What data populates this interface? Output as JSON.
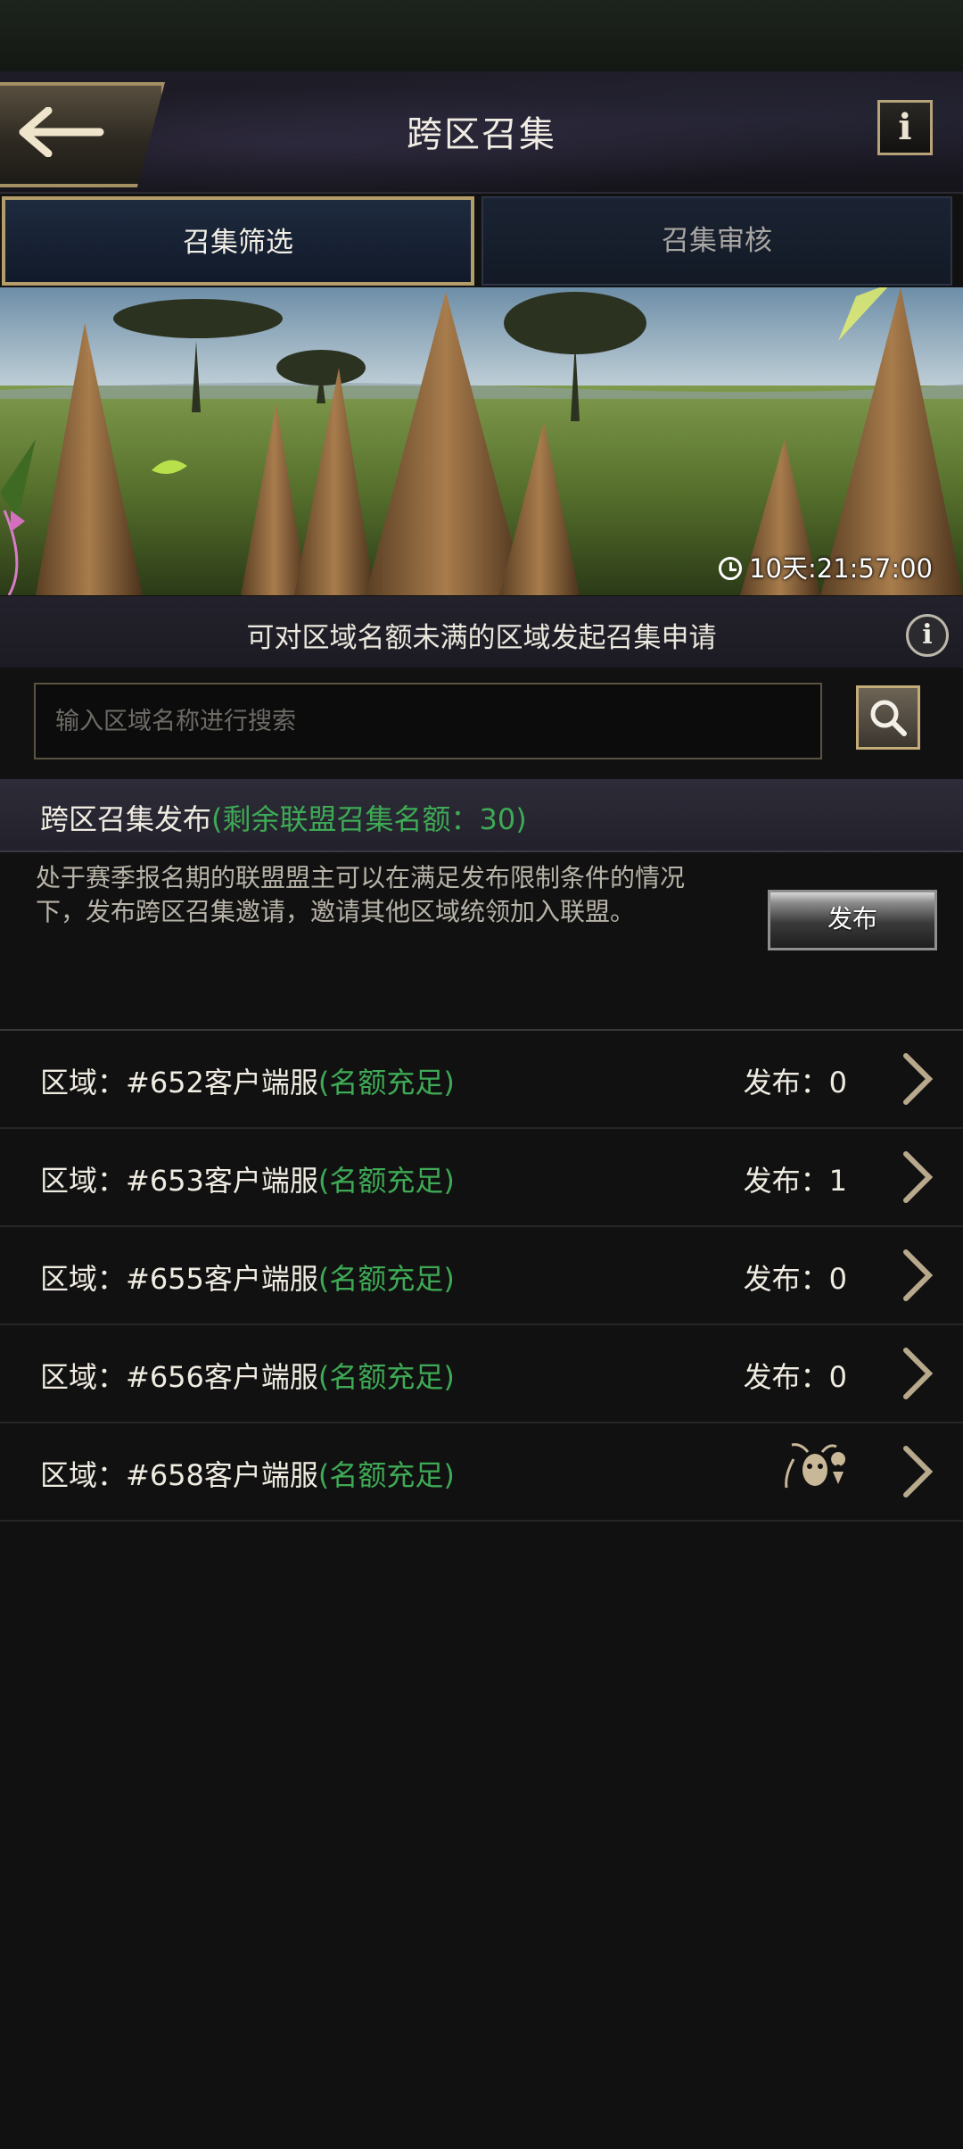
{
  "header": {
    "title": "跨区召集",
    "info_label": "i"
  },
  "tabs": [
    {
      "label": "召集筛选",
      "active": true
    },
    {
      "label": "召集审核",
      "active": false
    }
  ],
  "banner": {
    "timer": "10天:21:57:00"
  },
  "notice": {
    "text": "可对区域名额未满的区域发起召集申请",
    "info_label": "i"
  },
  "search": {
    "placeholder": "输入区域名称进行搜索",
    "value": ""
  },
  "publish_section": {
    "title": "跨区召集发布",
    "quota": "(剩余联盟召集名额：30)",
    "description": "处于赛季报名期的联盟盟主可以在满足发布限制条件的情况下，发布跨区召集邀请，邀请其他区域统领加入联盟。",
    "button_label": "发布"
  },
  "regions": [
    {
      "label": "区域：#652客户端服",
      "status": "(名额充足)",
      "count": "发布：0"
    },
    {
      "label": "区域：#653客户端服",
      "status": "(名额充足)",
      "count": "发布：1"
    },
    {
      "label": "区域：#655客户端服",
      "status": "(名额充足)",
      "count": "发布：0"
    },
    {
      "label": "区域：#656客户端服",
      "status": "(名额充足)",
      "count": "发布：0"
    },
    {
      "label": "区域：#658客户端服",
      "status": "(名额充足)",
      "count": "",
      "icon": "ant-location-icon"
    }
  ],
  "colors": {
    "accent_gold": "#b59d6a",
    "status_green": "#3eaa55",
    "background": "#111111"
  }
}
